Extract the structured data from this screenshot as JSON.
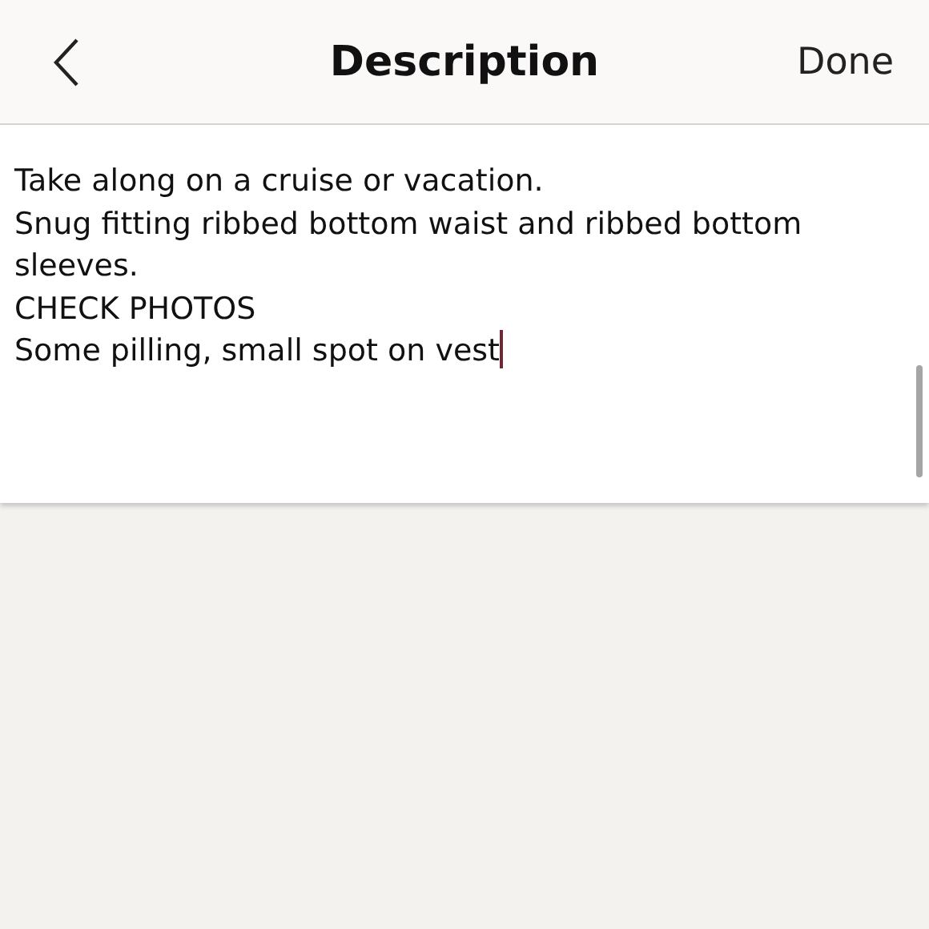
{
  "header": {
    "title": "Description",
    "done_button": "Done"
  },
  "description": {
    "value": "Take along on a cruise or vacation.\nSnug fitting ribbed bottom waist and ribbed bottom sleeves.\nCHECK PHOTOS\nSome pilling, small spot on vest",
    "focused": true
  }
}
